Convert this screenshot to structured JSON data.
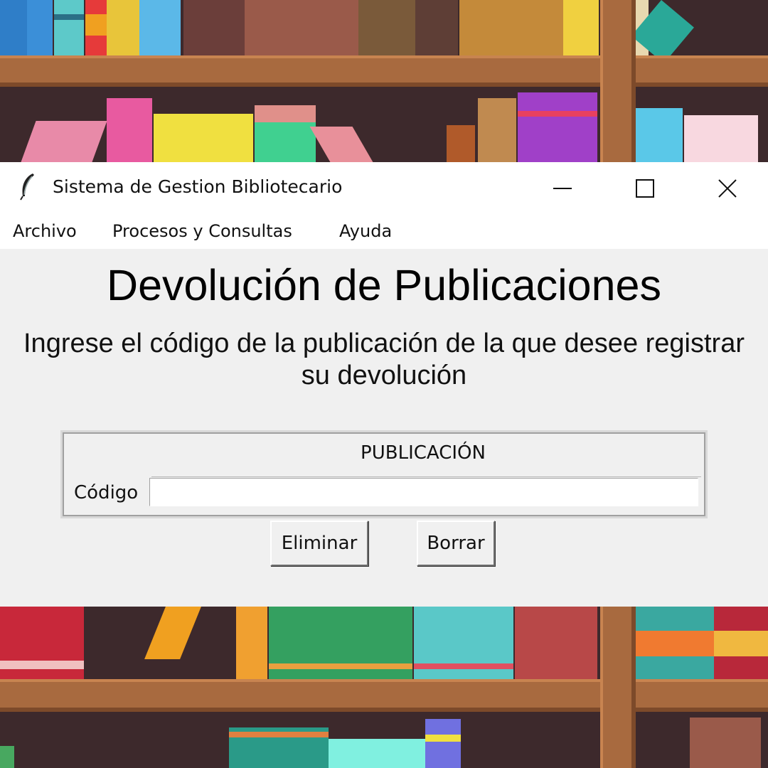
{
  "window": {
    "title": "Sistema de Gestion Bibliotecario",
    "icon": "feather-icon",
    "controls": [
      "minimize-icon",
      "maximize-icon",
      "close-icon"
    ]
  },
  "menu": {
    "items": [
      "Archivo",
      "Procesos y Consultas",
      "Ayuda"
    ]
  },
  "main": {
    "heading": "Devolución de Publicaciones",
    "instructions_line1": "Ingrese el código de la publicación de la que desee registrar",
    "instructions_line2": "su devolución",
    "panel": {
      "title": "PUBLICACIÓN",
      "code_label": "Código",
      "code_value": ""
    },
    "buttons": {
      "delete": "Eliminar",
      "clear": "Borrar"
    }
  },
  "colors": {
    "window_bg": "#f0f0f0",
    "titlebar_bg": "#ffffff",
    "shelf_wood": "#a86a3f",
    "shelf_back": "#3d292c"
  }
}
